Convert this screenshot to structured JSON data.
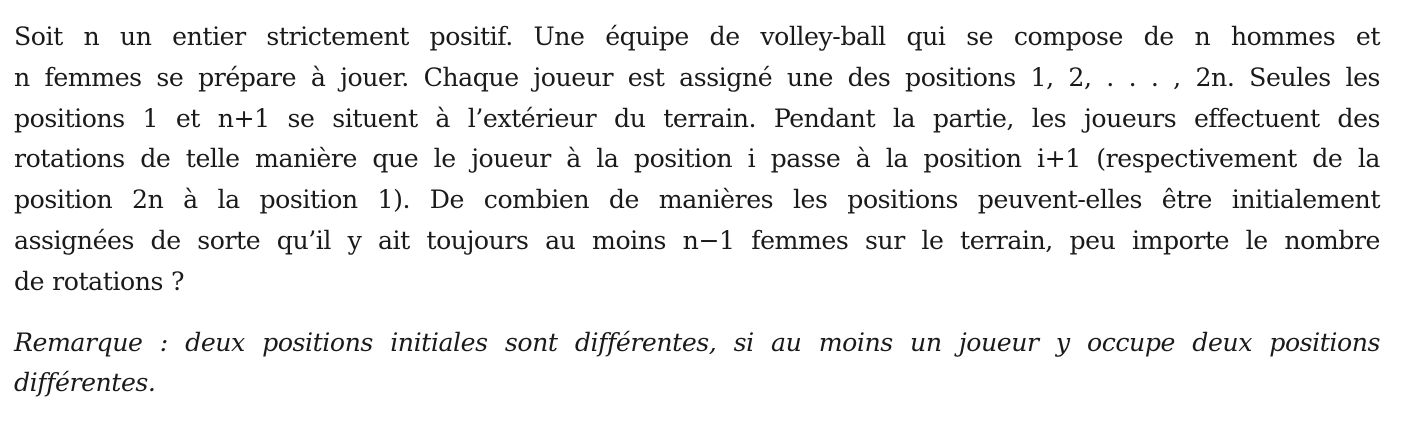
{
  "problem": {
    "lines": [
      "Soit n un entier strictement positif. Une équipe de volley-ball qui se compose de n hommes et",
      "n femmes se prépare à jouer. Chaque joueur est assigné une des positions 1, 2, . . . , 2n. Seules les",
      "positions 1 et n+1 se situent à l’extérieur du terrain. Pendant la partie, les joueurs effectuent des",
      "rotations de telle manière que le joueur à la position i passe à la position i+1 (respectivement de la",
      "position 2n à la position 1). De combien de manières les positions peuvent-elles être initialement",
      "assignées de sorte qu’il y ait toujours au moins n−1 femmes sur le terrain, peu importe le nombre",
      "de rotations ?"
    ]
  },
  "remark": {
    "lines": [
      "Remarque : deux positions initiales sont différentes, si au moins un joueur y occupe deux positions",
      "différentes."
    ]
  }
}
